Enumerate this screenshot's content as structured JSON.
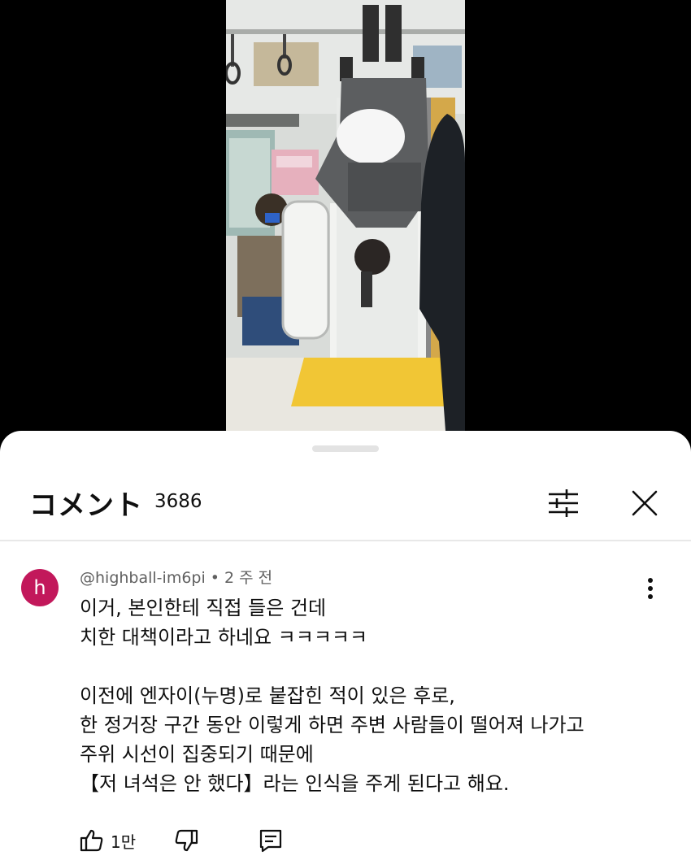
{
  "video": {
    "description_icon": "subway-video-frame"
  },
  "comments_sheet": {
    "title": "コメント",
    "count": "3686",
    "filter_icon": "sliders-icon",
    "close_icon": "close-icon"
  },
  "comment": {
    "avatar_letter": "h",
    "avatar_color": "#c2185b",
    "author": "@highball-im6pi",
    "separator": "•",
    "time": "2 주 전",
    "lines": [
      "이거, 본인한테 직접 들은 건데",
      "치한 대책이라고 하네요 ㅋㅋㅋㅋㅋ",
      "",
      "이전에 엔자이(누명)로 붙잡힌 적이 있은 후로,",
      "한 정거장 구간 동안 이렇게 하면 주변 사람들이 떨어져 나가고",
      "주위 시선이 집중되기 때문에",
      "【저 녀석은 안 했다】라는 인식을 주게 된다고 해요."
    ],
    "likes": "1만",
    "like_icon": "thumbs-up-icon",
    "dislike_icon": "thumbs-down-icon",
    "reply_icon": "reply-icon",
    "more_icon": "more-vert-icon"
  }
}
